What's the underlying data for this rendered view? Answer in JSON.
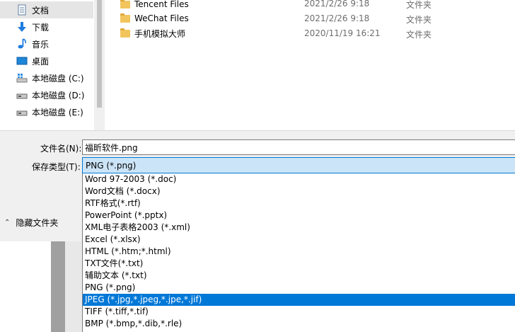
{
  "nav": {
    "items": [
      {
        "label": "文档",
        "icon": "document-icon",
        "selected": true
      },
      {
        "label": "下载",
        "icon": "download-icon"
      },
      {
        "label": "音乐",
        "icon": "music-icon"
      },
      {
        "label": "桌面",
        "icon": "desktop-icon"
      },
      {
        "label": "本地磁盘 (C:)",
        "icon": "drive-c-icon"
      },
      {
        "label": "本地磁盘 (D:)",
        "icon": "drive-icon"
      },
      {
        "label": "本地磁盘 (E:)",
        "icon": "drive-icon"
      }
    ]
  },
  "files": [
    {
      "name": "Tencent Files",
      "date": "2021/2/26 9:18",
      "type": "文件夹"
    },
    {
      "name": "WeChat Files",
      "date": "2021/2/26 9:18",
      "type": "文件夹"
    },
    {
      "name": "手机模拟大师",
      "date": "2020/11/19 16:21",
      "type": "文件夹"
    }
  ],
  "save": {
    "filename_label": "文件名(N):",
    "filename_value": "福昕软件.png",
    "type_label": "保存类型(T):",
    "type_selected": "PNG (*.png)",
    "hide_folders_label": "隐藏文件夹"
  },
  "type_options": [
    "Word 97-2003 (*.doc)",
    "Word文档 (*.docx)",
    "RTF格式(*.rtf)",
    "PowerPoint (*.pptx)",
    "XML电子表格2003 (*.xml)",
    "Excel (*.xlsx)",
    "HTML (*.htm;*.html)",
    "TXT文件(*.txt)",
    "辅助文本 (*.txt)",
    "PNG (*.png)",
    "JPEG (*.jpg,*.jpeg,*.jpe,*.jif)",
    "TIFF (*.tiff,*.tif)",
    "BMP (*.bmp,*.dib,*.rle)"
  ],
  "highlighted_option_index": 10,
  "colors": {
    "accent": "#0078d7",
    "selected_field": "#cce4f7",
    "folder": "#f2c55c"
  }
}
